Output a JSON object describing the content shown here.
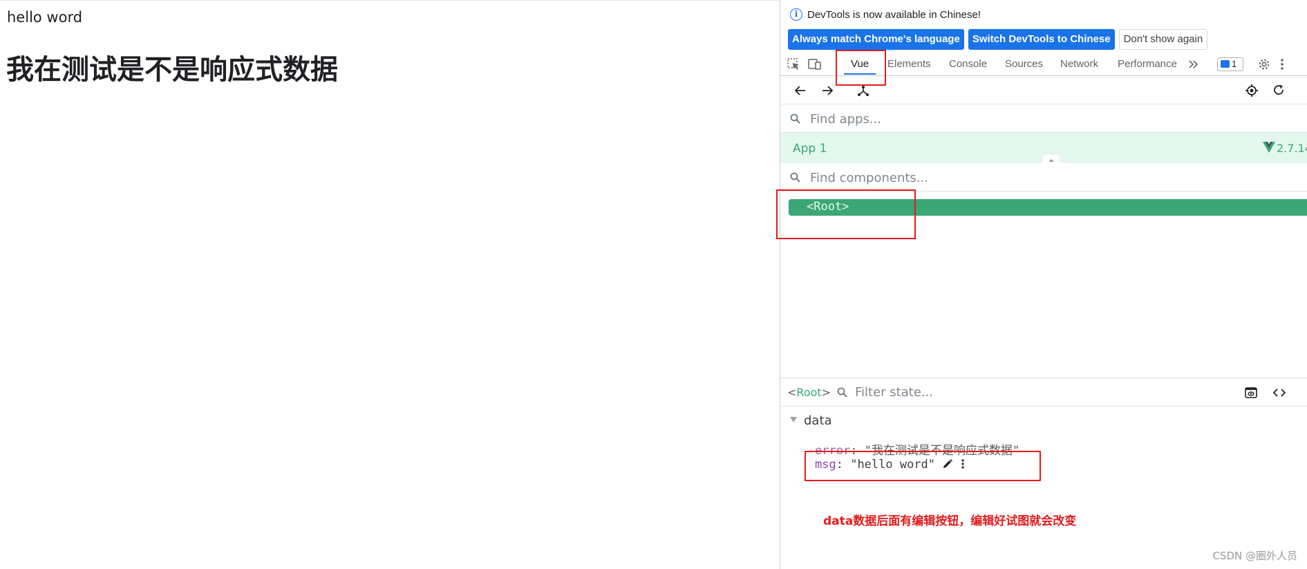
{
  "page": {
    "paragraph": "hello word",
    "heading": "我在测试是不是响应式数据"
  },
  "devtools": {
    "infobar": {
      "message": "DevTools is now available in Chinese!",
      "buttons": {
        "match_language": "Always match Chrome's language",
        "switch_chinese": "Switch DevTools to Chinese",
        "dont_show": "Don't show again"
      }
    },
    "tabs": [
      "Vue",
      "Elements",
      "Console",
      "Sources",
      "Network",
      "Performance"
    ],
    "active_tab": "Vue",
    "issues_count": "1",
    "app_search": {
      "placeholder": "Find apps..."
    },
    "app": {
      "name": "App 1",
      "version": "2.7.14"
    },
    "component_search": {
      "placeholder": "Find components..."
    },
    "tree": {
      "root_tag": "<Root>"
    },
    "state": {
      "crumb_open": "<",
      "crumb_name": "Root",
      "crumb_close": ">",
      "filter_placeholder": "Filter state...",
      "section": "data",
      "props": [
        {
          "key": "error",
          "value": "\"我在测试是不是响应式数据\""
        },
        {
          "key": "msg",
          "value": "\"hello word\""
        }
      ]
    }
  },
  "annotation": "data数据后面有编辑按钮，编辑好试图就会改变",
  "watermark": "CSDN @圈外人员",
  "colors": {
    "vue_green": "#3aa876",
    "chrome_blue": "#1a73e8",
    "annotation_red": "#e31b1b"
  }
}
